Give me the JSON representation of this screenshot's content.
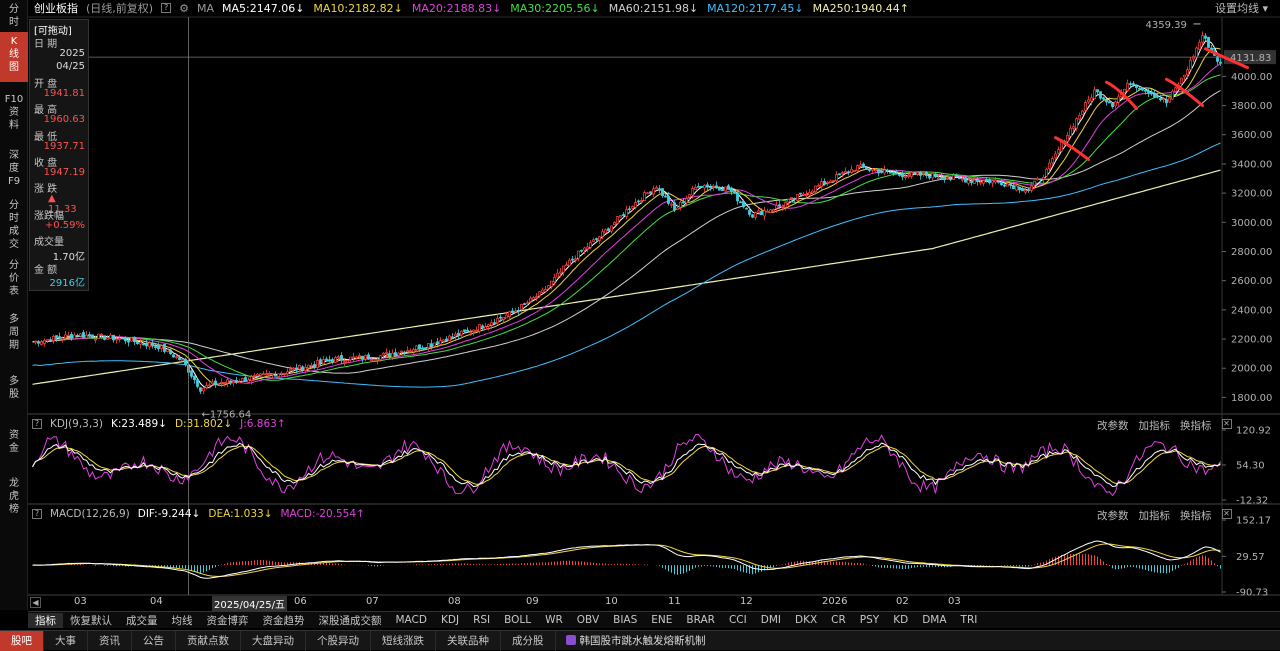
{
  "left_rail": [
    {
      "label": "分\n时",
      "top": 0,
      "h": 26
    },
    {
      "label": "K\n线\n图",
      "top": 32,
      "h": 50,
      "active": true
    },
    {
      "label": "F10\n资\n料",
      "top": 90,
      "h": 52
    },
    {
      "label": "深\n度\nF9",
      "top": 146,
      "h": 46
    },
    {
      "label": "分\n时\n成\n交",
      "top": 196,
      "h": 58
    },
    {
      "label": "分\n价\n表",
      "top": 256,
      "h": 46
    },
    {
      "label": "多\n周\n期",
      "top": 310,
      "h": 46
    },
    {
      "label": "多\n股",
      "top": 372,
      "h": 34
    },
    {
      "label": "资\n金",
      "top": 426,
      "h": 34
    },
    {
      "label": "龙\n虎\n榜",
      "top": 474,
      "h": 48
    }
  ],
  "header": {
    "title": "创业板指",
    "mode": "(日线,前复权)",
    "ma_label": "MA",
    "set_ma": "设置均线",
    "ma": [
      {
        "text": "MA5:2147.06",
        "arrow": "↓",
        "color": "#ffffff"
      },
      {
        "text": "MA10:2182.82",
        "arrow": "↓",
        "color": "#f0d640"
      },
      {
        "text": "MA20:2188.83",
        "arrow": "↓",
        "color": "#e040e0"
      },
      {
        "text": "MA30:2205.56",
        "arrow": "↓",
        "color": "#40e040"
      },
      {
        "text": "MA60:2151.98",
        "arrow": "↓",
        "color": "#d0d0d0"
      },
      {
        "text": "MA120:2177.45",
        "arrow": "↓",
        "color": "#40c0ff"
      },
      {
        "text": "MA250:1940.44",
        "arrow": "↑",
        "color": "#f0f0b0"
      }
    ]
  },
  "info_panel": {
    "drag": "[可拖动]",
    "date_label": "日 期",
    "year": "2025",
    "md": "04/25",
    "open_label": "开 盘",
    "open": "1941.81",
    "high_label": "最 高",
    "high": "1960.63",
    "low_label": "最 低",
    "low": "1937.71",
    "close_label": "收 盘",
    "close": "1947.19",
    "change_label": "涨 跌",
    "change": "▲ 11.33",
    "pct_label": "涨跌幅",
    "pct": "+0.59%",
    "vol_label": "成交量",
    "vol": "1.70亿",
    "amt_label": "金 额",
    "amt": "2916亿"
  },
  "colors": {
    "up": "#ff4040",
    "down": "#40d0e0",
    "k": "#ffffff",
    "d": "#f0d640",
    "j": "#e040e0",
    "dif": "#ffffff",
    "dea": "#f0d640"
  },
  "main_chart": {
    "yticks": [
      "4000.00",
      "3800.00",
      "3600.00",
      "3400.00",
      "3200.00",
      "3000.00",
      "2800.00",
      "2600.00",
      "2400.00",
      "2200.00",
      "2000.00",
      "1800.00"
    ],
    "high_label": "4359.39",
    "low_label": "←1756.64",
    "cursor_label": "4131.83",
    "high_value": 4359.39,
    "low_value": 1756.64,
    "cursor_value": 4131.83
  },
  "kdj": {
    "title": "KDJ(9,3,3)",
    "k": "K:23.489",
    "k_arrow": "↓",
    "d": "D:31.802",
    "d_arrow": "↓",
    "j": "J:6.863",
    "j_arrow": "↑",
    "yticks": [
      "120.92",
      "54.30",
      "-12.32"
    ]
  },
  "macd": {
    "title": "MACD(12,26,9)",
    "dif": "DIF:-9.244",
    "dif_arrow": "↓",
    "dea": "DEA:1.033",
    "dea_arrow": "↓",
    "macd": "MACD:-20.554",
    "macd_arrow": "↑",
    "yticks": [
      "152.17",
      "29.57",
      "-90.73"
    ]
  },
  "pane_controls": [
    "改参数",
    "加指标",
    "换指标"
  ],
  "xaxis": {
    "labels": [
      "03",
      "04",
      "2025/04/25/五",
      "06",
      "07",
      "08",
      "09",
      "10",
      "11",
      "12",
      "2026",
      "02",
      "03"
    ],
    "highlight_index": 2
  },
  "indicator_tabs": [
    "指标",
    "恢复默认",
    "成交量",
    "均线",
    "资金博弈",
    "资金趋势",
    "深股通成交额",
    "MACD",
    "KDJ",
    "RSI",
    "BOLL",
    "WR",
    "OBV",
    "BIAS",
    "ENE",
    "BRAR",
    "CCI",
    "DMI",
    "DKX",
    "CR",
    "PSY",
    "KD",
    "DMA",
    "TRI"
  ],
  "indicator_active": 0,
  "bottom_tabs": [
    "股吧",
    "大事",
    "资讯",
    "公告",
    "贡献点数",
    "大盘异动",
    "个股异动",
    "短线涨跌",
    "关联品种",
    "成分股"
  ],
  "bottom_active": 0,
  "news": "韩国股市跳水触发熔断机制"
}
